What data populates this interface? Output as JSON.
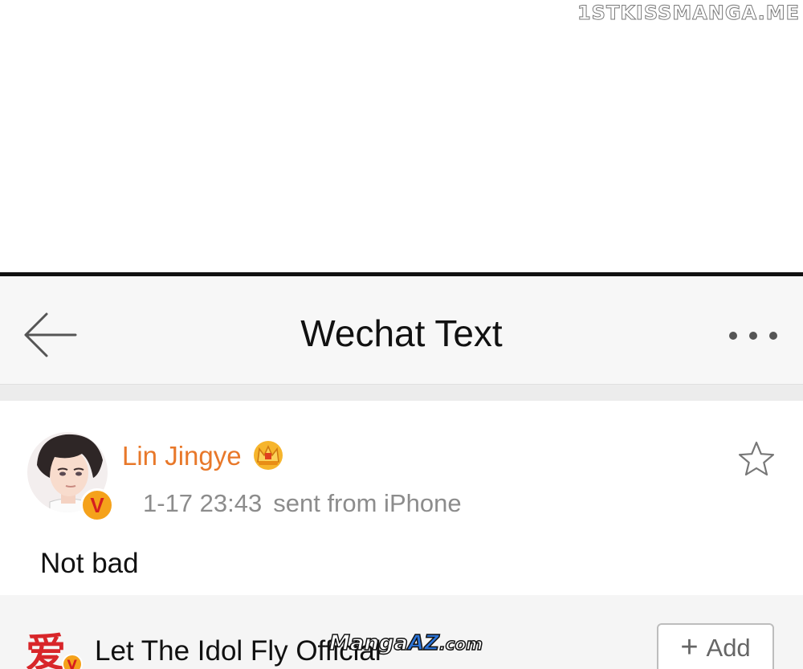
{
  "watermark": {
    "text": "1STKISSMANGA.ME"
  },
  "header": {
    "title": "Wechat Text",
    "back_icon": "arrow-left-icon",
    "more_icon": "more-dots-icon"
  },
  "post": {
    "author": "Lin Jingye",
    "author_color": "#e8782a",
    "crown_icon": "crown-icon",
    "verified_badge": "V",
    "time": "1-17 23:43",
    "source": "sent from iPhone",
    "text": "Not bad",
    "favorite_icon": "star-outline-icon"
  },
  "next_post": {
    "author": "Let The Idol Fly Official",
    "avatar_glyph": "爱",
    "avatar_badge": "V",
    "add_label": "Add"
  },
  "logo": {
    "part1": "Manga",
    "part2": "AZ",
    "part3": ".com"
  }
}
